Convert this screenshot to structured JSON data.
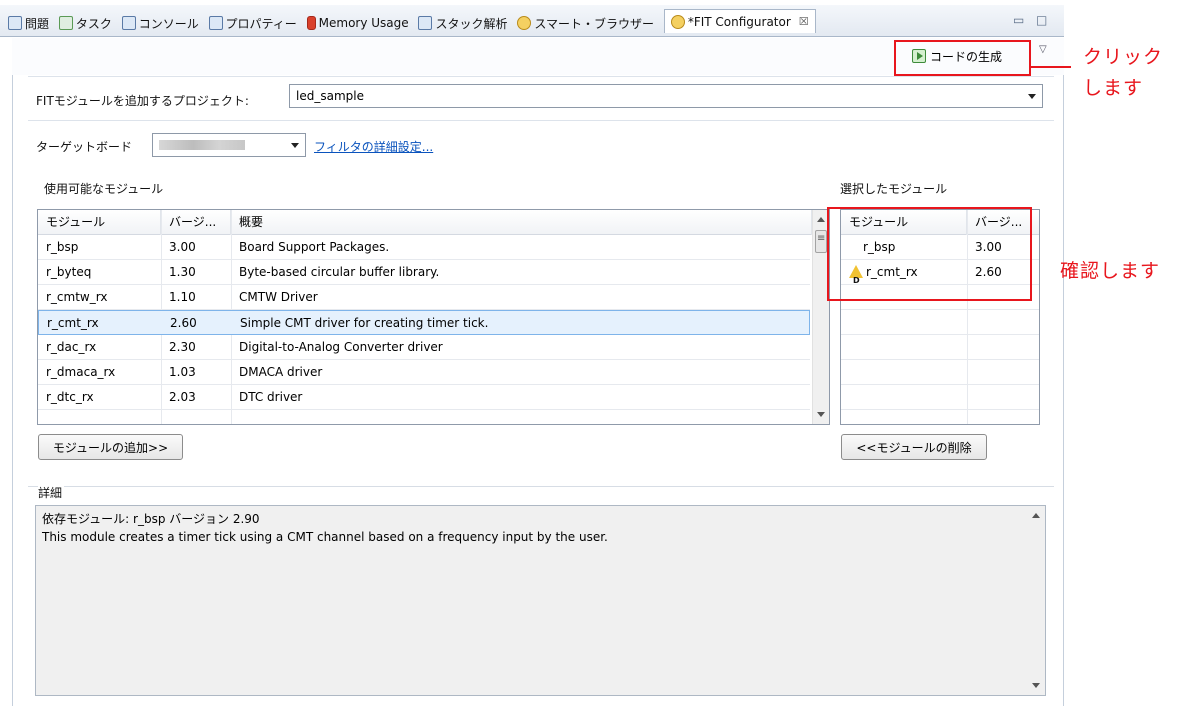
{
  "tabs": [
    {
      "label": "問題",
      "icon": "problems-icon"
    },
    {
      "label": "タスク",
      "icon": "tasks-icon"
    },
    {
      "label": "コンソール",
      "icon": "console-icon"
    },
    {
      "label": "プロパティー",
      "icon": "properties-icon"
    },
    {
      "label": "Memory Usage",
      "icon": "memory-usage-icon"
    },
    {
      "label": "スタック解析",
      "icon": "stack-analysis-icon"
    },
    {
      "label": "スマート・ブラウザー",
      "icon": "smart-browser-icon"
    }
  ],
  "active_tab": {
    "label": "*FIT Configurator",
    "close": "☒"
  },
  "window_controls": {
    "minimize": "▭",
    "maximize": "□"
  },
  "toolbar": {
    "generate_label": "コードの生成",
    "view_menu": "▽"
  },
  "project": {
    "label": "FITモジュールを追加するプロジェクト:",
    "value": "led_sample"
  },
  "target": {
    "label": "ターゲットボード",
    "filter_link": "フィルタの詳細設定..."
  },
  "available": {
    "title": "使用可能なモジュール",
    "columns": [
      "モジュール",
      "バージ...",
      "概要"
    ],
    "rows": [
      {
        "module": "r_bsp",
        "version": "3.00",
        "summary": "Board Support Packages."
      },
      {
        "module": "r_byteq",
        "version": "1.30",
        "summary": "Byte-based circular buffer library."
      },
      {
        "module": "r_cmtw_rx",
        "version": "1.10",
        "summary": "CMTW Driver"
      },
      {
        "module": "r_cmt_rx",
        "version": "2.60",
        "summary": "Simple CMT driver for creating timer tick."
      },
      {
        "module": "r_dac_rx",
        "version": "2.30",
        "summary": "Digital-to-Analog Converter driver"
      },
      {
        "module": "r_dmaca_rx",
        "version": "1.03",
        "summary": "DMACA driver"
      },
      {
        "module": "r_dtc_rx",
        "version": "2.03",
        "summary": "DTC driver"
      }
    ],
    "selected_row_index": 3,
    "add_button": "モジュールの追加>>"
  },
  "selected": {
    "title": "選択したモジュール",
    "columns": [
      "モジュール",
      "バージ..."
    ],
    "rows": [
      {
        "module": "r_bsp",
        "version": "3.00",
        "warning": false
      },
      {
        "module": "r_cmt_rx",
        "version": "2.60",
        "warning": true
      }
    ],
    "remove_button": "<<モジュールの削除"
  },
  "details": {
    "title": "詳細",
    "line1": "依存モジュール: r_bsp バージョン 2.90",
    "line2": "This module creates a timer tick using a CMT channel based on a frequency input by the user."
  },
  "annotations": {
    "click_text_line1": "クリック",
    "click_text_line2": "します",
    "confirm_text": "確認します",
    "color": "#e8161d"
  }
}
